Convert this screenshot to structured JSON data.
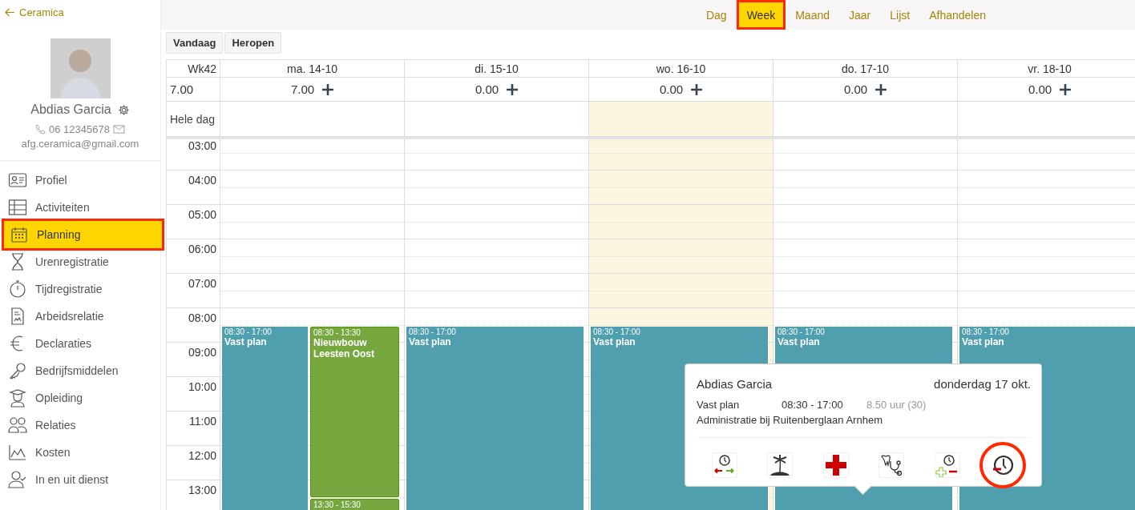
{
  "sidebar": {
    "back_link": "Ceramica",
    "user": {
      "name": "Abdias Garcia",
      "phone": "06 12345678",
      "email": "afg.ceramica@gmail.com"
    },
    "items": [
      {
        "label": "Profiel",
        "selected": false,
        "highlighted": false
      },
      {
        "label": "Activiteiten",
        "selected": false,
        "highlighted": false
      },
      {
        "label": "Planning",
        "selected": true,
        "highlighted": true
      },
      {
        "label": "Urenregistratie",
        "selected": false,
        "highlighted": false
      },
      {
        "label": "Tijdregistratie",
        "selected": false,
        "highlighted": false
      },
      {
        "label": "Arbeidsrelatie",
        "selected": false,
        "highlighted": false
      },
      {
        "label": "Declaraties",
        "selected": false,
        "highlighted": false
      },
      {
        "label": "Bedrijfsmiddelen",
        "selected": false,
        "highlighted": false
      },
      {
        "label": "Opleiding",
        "selected": false,
        "highlighted": false
      },
      {
        "label": "Relaties",
        "selected": false,
        "highlighted": false
      },
      {
        "label": "Kosten",
        "selected": false,
        "highlighted": false
      },
      {
        "label": "In en uit dienst",
        "selected": false,
        "highlighted": false
      }
    ]
  },
  "view_tabs": [
    {
      "label": "Dag",
      "selected": false,
      "highlighted": false
    },
    {
      "label": "Week",
      "selected": true,
      "highlighted": true
    },
    {
      "label": "Maand",
      "selected": false,
      "highlighted": false
    },
    {
      "label": "Jaar",
      "selected": false,
      "highlighted": false
    },
    {
      "label": "Lijst",
      "selected": false,
      "highlighted": false
    },
    {
      "label": "Afhandelen",
      "selected": false,
      "highlighted": false
    }
  ],
  "toolbar": {
    "buttons": [
      "Vandaag",
      "Heropen"
    ]
  },
  "calendar": {
    "week": "Wk42",
    "week_total": "7.00",
    "all_day_label": "Hele dag",
    "hours": [
      "03:00",
      "04:00",
      "05:00",
      "06:00",
      "07:00",
      "08:00",
      "09:00",
      "10:00",
      "11:00",
      "12:00",
      "13:00"
    ],
    "days": [
      {
        "label": "ma. 14-10",
        "total": "7.00",
        "today": false,
        "events": [
          {
            "kind": "plan",
            "time": "08:30 - 17:00",
            "title": "Vast plan"
          },
          {
            "kind": "project",
            "time": "08:30 - 13:30",
            "title": "Nieuwbouw Leesten Oost"
          },
          {
            "kind": "project",
            "time": "13:30 - 15:30"
          }
        ]
      },
      {
        "label": "di. 15-10",
        "total": "0.00",
        "today": false,
        "events": [
          {
            "kind": "plan",
            "time": "08:30 - 17:00",
            "title": "Vast plan"
          }
        ]
      },
      {
        "label": "wo. 16-10",
        "total": "0.00",
        "today": true,
        "events": [
          {
            "kind": "plan",
            "time": "08:30 - 17:00",
            "title": "Vast plan"
          }
        ]
      },
      {
        "label": "do. 17-10",
        "total": "0.00",
        "today": false,
        "events": [
          {
            "kind": "plan",
            "time": "08:30 - 17:00",
            "title": "Vast plan"
          }
        ]
      },
      {
        "label": "vr. 18-10",
        "total": "0.00",
        "today": false,
        "events": [
          {
            "kind": "plan",
            "time": "08:30 - 17:00",
            "title": "Vast plan"
          }
        ]
      }
    ]
  },
  "popover": {
    "name": "Abdias Garcia",
    "date": "donderdag 17 okt.",
    "type": "Vast plan",
    "time": "08:30 - 17:00",
    "hours": "8.50 uur (30)",
    "description": "Administratie bij Ruitenberglaan Arnhem",
    "actions": [
      {
        "highlighted": false
      },
      {
        "highlighted": false
      },
      {
        "highlighted": false
      },
      {
        "highlighted": false
      },
      {
        "highlighted": false
      },
      {
        "highlighted": true
      }
    ]
  }
}
